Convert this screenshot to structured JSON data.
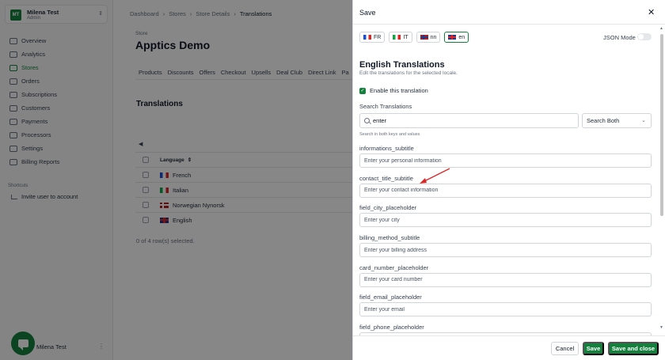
{
  "account": {
    "initials": "MT",
    "name": "Milena Test",
    "role": "Admin"
  },
  "sidebar": {
    "items": [
      {
        "label": "Overview",
        "active": false
      },
      {
        "label": "Analytics",
        "active": false
      },
      {
        "label": "Stores",
        "active": true
      },
      {
        "label": "Orders",
        "active": false
      },
      {
        "label": "Subscriptions",
        "active": false
      },
      {
        "label": "Customers",
        "active": false
      },
      {
        "label": "Payments",
        "active": false
      },
      {
        "label": "Processors",
        "active": false
      },
      {
        "label": "Settings",
        "active": false
      },
      {
        "label": "Billing Reports",
        "active": false
      }
    ],
    "shortcuts_title": "Shortcuts",
    "invite_label": "Invite user to account",
    "footer_user": "Milena Test"
  },
  "breadcrumb": [
    "Dashboard",
    "Stores",
    "Store Details",
    "Translations"
  ],
  "store": {
    "label": "Store",
    "title": "Apptics Demo"
  },
  "tabs": [
    "Products",
    "Discounts",
    "Offers",
    "Checkout",
    "Upsells",
    "Deal Club",
    "Direct Link",
    "Pa"
  ],
  "translations_section": {
    "title": "Translations",
    "column_header": "Language",
    "rows": [
      "French",
      "Italian",
      "Norwegian Nynorsk",
      "English"
    ],
    "footer": "0 of 4 row(s) selected."
  },
  "dialog": {
    "title": "Save",
    "locales": [
      {
        "label": "FR",
        "active": false
      },
      {
        "label": "IT",
        "active": false
      },
      {
        "label": "nn",
        "active": false
      },
      {
        "label": "en",
        "active": true
      }
    ],
    "json_mode_label": "JSON Mode",
    "heading": "English Translations",
    "subheading": "Edit the translations for the selected locale.",
    "enable_label": "Enable this translation",
    "search_label": "Search Translations",
    "search_value": "enter",
    "search_scope": "Search Both",
    "search_hint": "Search in both keys and values",
    "fields": [
      {
        "key": "informations_subtitle",
        "value": "Enter your personal information"
      },
      {
        "key": "contact_title_subtitle",
        "value": "Enter your contact information"
      },
      {
        "key": "field_city_placeholder",
        "value": "Enter your city"
      },
      {
        "key": "billing_method_subtitle",
        "value": "Enter your billing address"
      },
      {
        "key": "card_number_placeholder",
        "value": "Enter your card number"
      },
      {
        "key": "field_email_placeholder",
        "value": "Enter your email"
      },
      {
        "key": "field_phone_placeholder",
        "value": ""
      }
    ],
    "buttons": {
      "cancel": "Cancel",
      "save": "Save",
      "save_close": "Save and close"
    }
  },
  "colors": {
    "accent": "#15803d",
    "annotation_arrow": "#dc2626"
  }
}
